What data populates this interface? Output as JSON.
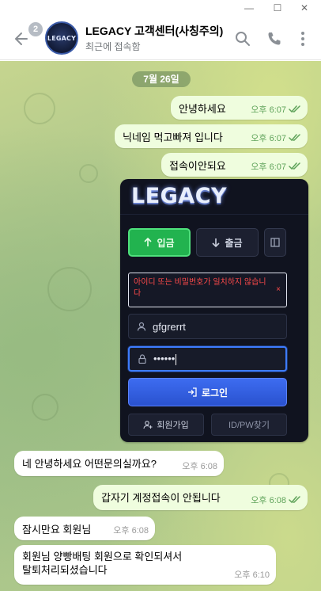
{
  "window": {
    "minimize_glyph": "—",
    "maximize_glyph": "☐",
    "close_glyph": "✕"
  },
  "header": {
    "back_icon": "arrow-left-icon",
    "unread_count": "2",
    "avatar_text": "LEGACY",
    "title": "LEGACY 고객센터(사칭주의)",
    "status": "최근에 접속함",
    "icons": [
      "search-icon",
      "phone-icon",
      "more-vertical-icon"
    ]
  },
  "chat": {
    "date": "7월 26일",
    "messages": [
      {
        "dir": "out",
        "text": "안녕하세요",
        "time": "오후 6:07",
        "read": true
      },
      {
        "dir": "out",
        "text": "닉네임 먹고빠져 입니다",
        "time": "오후 6:07",
        "read": true
      },
      {
        "dir": "out",
        "text": "접속이안되요",
        "time": "오후 6:07",
        "read": true
      },
      {
        "dir": "in",
        "text": "네 안녕하세요 어떤문의실까요?",
        "time": "오후 6:08"
      },
      {
        "dir": "out",
        "text": "갑자기 계정접속이 안됩니다",
        "time": "오후 6:08",
        "read": true
      },
      {
        "dir": "in",
        "text": "잠시만요 회원님",
        "time": "오후 6:08"
      },
      {
        "dir": "in",
        "text": "회원님 양빵배팅 회원으로 확인되셔서\n탈퇴처리되셨습니다",
        "time": "오후 6:10"
      }
    ]
  },
  "screenshot": {
    "logo": "LEGACY",
    "tab_deposit": "입금",
    "tab_withdraw": "출금",
    "error": "아이디 또는 비밀번호가 일치하지 않습니다",
    "error_close": "×",
    "username": "gfgrerrt",
    "password_mask": "••••••",
    "login": "로그인",
    "signup": "회원가입",
    "find": "ID/PW찾기"
  },
  "colors": {
    "outgoing_bubble": "#effdde",
    "incoming_bubble": "#ffffff",
    "read_check": "#5fa35a",
    "deposit_tab": "#22b34f",
    "login_button": "#2a52cf",
    "error_text": "#ff4a4a"
  }
}
